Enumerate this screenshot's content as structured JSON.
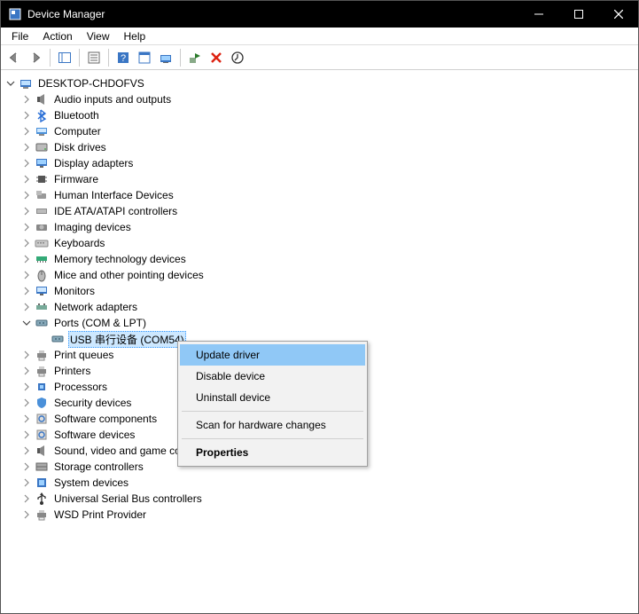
{
  "window": {
    "title": "Device Manager"
  },
  "menubar": [
    "File",
    "Action",
    "View",
    "Help"
  ],
  "root": {
    "label": "DESKTOP-CHDOFVS"
  },
  "categories": [
    {
      "label": "Audio inputs and outputs",
      "icon": "speaker"
    },
    {
      "label": "Bluetooth",
      "icon": "bluetooth"
    },
    {
      "label": "Computer",
      "icon": "computer"
    },
    {
      "label": "Disk drives",
      "icon": "disk"
    },
    {
      "label": "Display adapters",
      "icon": "display"
    },
    {
      "label": "Firmware",
      "icon": "chip"
    },
    {
      "label": "Human Interface Devices",
      "icon": "hid"
    },
    {
      "label": "IDE ATA/ATAPI controllers",
      "icon": "ide"
    },
    {
      "label": "Imaging devices",
      "icon": "imaging"
    },
    {
      "label": "Keyboards",
      "icon": "keyboard"
    },
    {
      "label": "Memory technology devices",
      "icon": "memory"
    },
    {
      "label": "Mice and other pointing devices",
      "icon": "mouse"
    },
    {
      "label": "Monitors",
      "icon": "monitor"
    },
    {
      "label": "Network adapters",
      "icon": "network"
    },
    {
      "label": "Ports (COM & LPT)",
      "icon": "port",
      "expanded": true,
      "children": [
        {
          "label": "USB 串行设备 (COM54)",
          "icon": "port",
          "selected": true
        }
      ]
    },
    {
      "label": "Print queues",
      "icon": "printer"
    },
    {
      "label": "Printers",
      "icon": "printer"
    },
    {
      "label": "Processors",
      "icon": "cpu"
    },
    {
      "label": "Security devices",
      "icon": "security"
    },
    {
      "label": "Software components",
      "icon": "sw"
    },
    {
      "label": "Software devices",
      "icon": "sw"
    },
    {
      "label": "Sound, video and game controllers",
      "icon": "speaker"
    },
    {
      "label": "Storage controllers",
      "icon": "storage"
    },
    {
      "label": "System devices",
      "icon": "system"
    },
    {
      "label": "Universal Serial Bus controllers",
      "icon": "usb"
    },
    {
      "label": "WSD Print Provider",
      "icon": "printer"
    }
  ],
  "contextmenu": {
    "items": [
      {
        "label": "Update driver",
        "highlight": true
      },
      {
        "label": "Disable device"
      },
      {
        "label": "Uninstall device"
      },
      {
        "sep": true
      },
      {
        "label": "Scan for hardware changes"
      },
      {
        "sep": true
      },
      {
        "label": "Properties",
        "bold": true
      }
    ]
  }
}
